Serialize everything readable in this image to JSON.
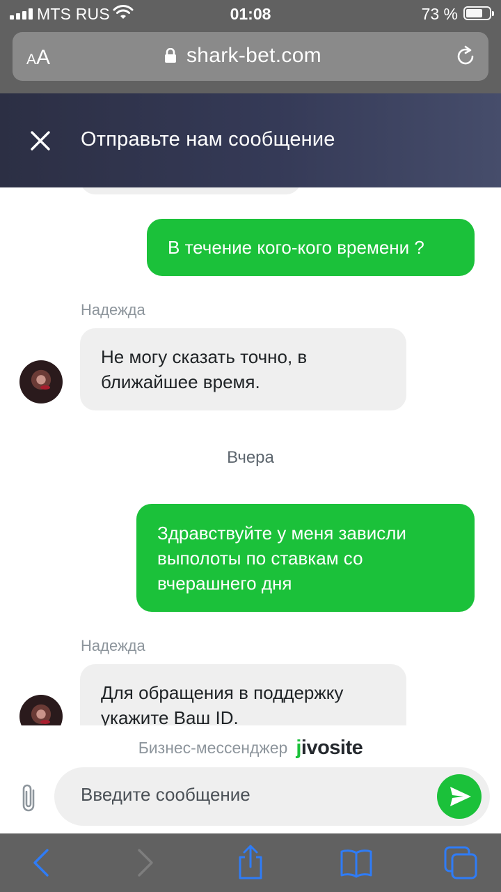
{
  "status_bar": {
    "carrier": "MTS RUS",
    "time": "01:08",
    "battery": "73 %",
    "battery_level": 0.73
  },
  "browser": {
    "text_size_label_small": "A",
    "text_size_label_large": "A",
    "url": "shark-bet.com"
  },
  "chat": {
    "header_title": "Отправьте нам сообщение",
    "messages": [
      {
        "direction": "out",
        "text": "В течение кого-кого времени ?"
      },
      {
        "direction": "in",
        "sender": "Надежда",
        "text": "Не могу сказать точно, в ближайшее время."
      },
      {
        "direction": "out",
        "text": "Здравствуйте у меня зависли выполоты по ставкам со вчерашнего дня"
      },
      {
        "direction": "in",
        "sender": "Надежда",
        "text": "Для обращения в поддержку укажите Ваш ID."
      }
    ],
    "date_separator": "Вчера",
    "branding_text": "Бизнес-мессенджер",
    "branding_logo_accent": "j",
    "branding_logo_rest": "ivosite",
    "input_placeholder": "Введите сообщение"
  },
  "colors": {
    "accent_green": "#1bc13a",
    "incoming_bubble": "#efefef",
    "header_dark": "#2c2f44",
    "ios_blue": "#2f7cf6"
  },
  "icons": [
    "close-icon",
    "paperclip-icon",
    "send-icon",
    "back-icon",
    "forward-icon",
    "share-icon",
    "bookmarks-icon",
    "tabs-icon",
    "lock-icon",
    "reload-icon",
    "wifi-icon"
  ]
}
